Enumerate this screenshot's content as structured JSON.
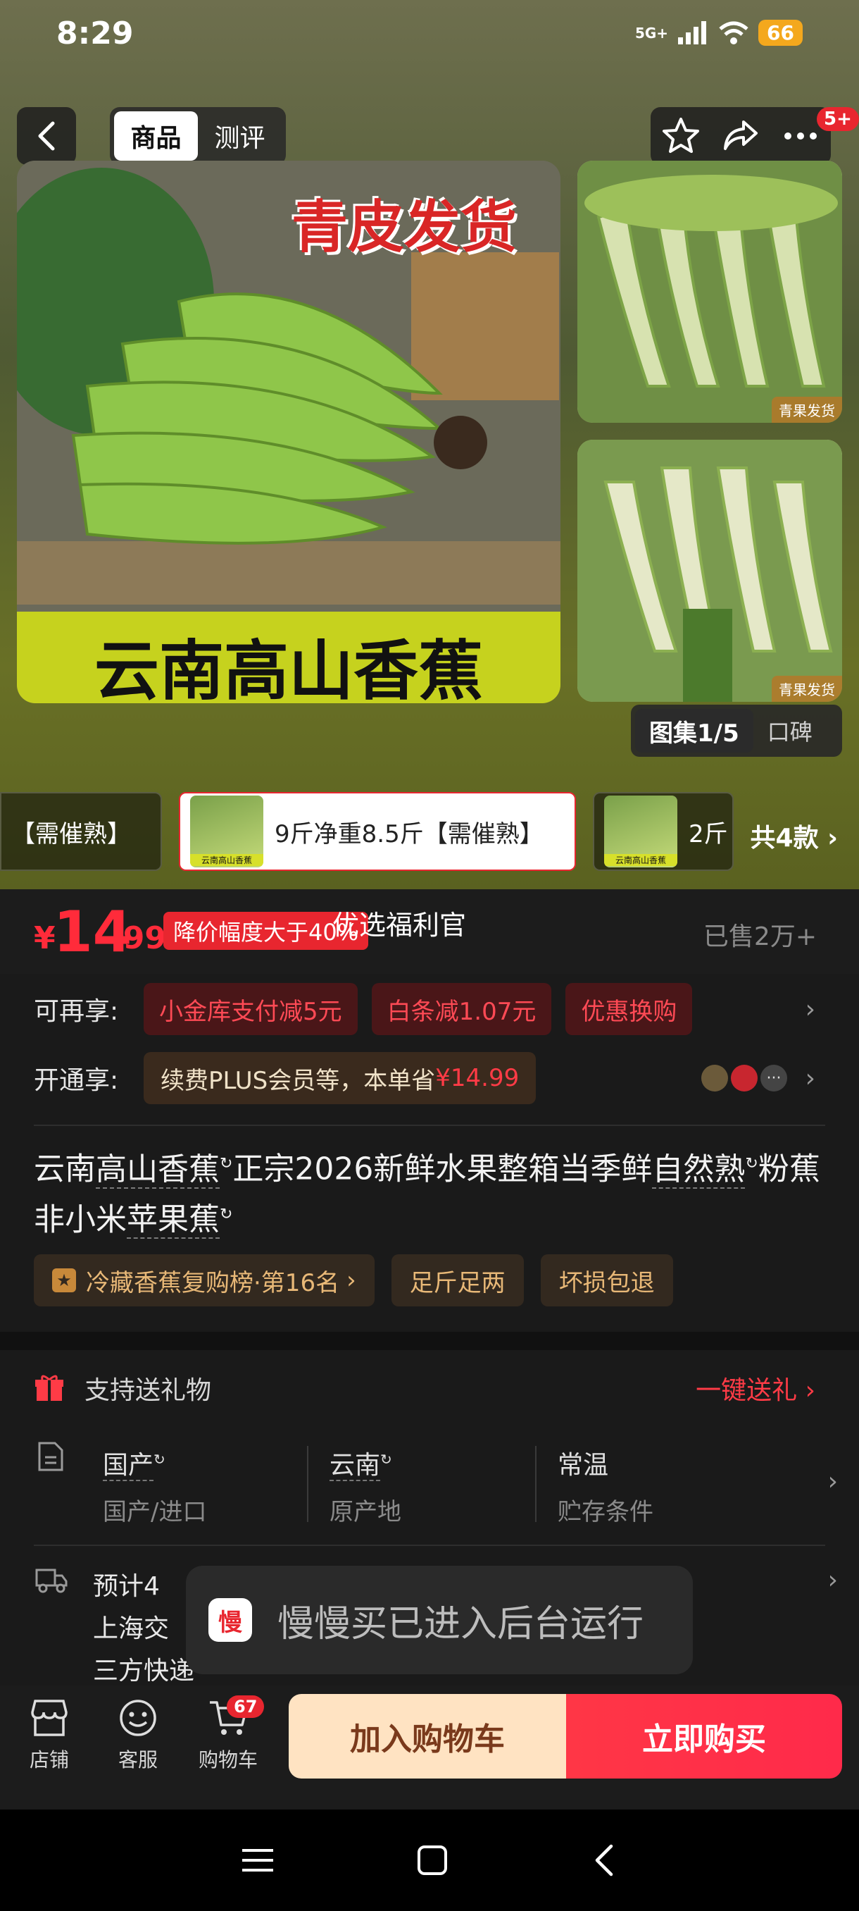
{
  "status": {
    "time": "8:29",
    "network": "5G+",
    "battery": "66"
  },
  "header": {
    "tabs": [
      {
        "label": "商品",
        "active": true
      },
      {
        "label": "测评",
        "active": false
      }
    ],
    "notification_badge": "5+"
  },
  "gallery": {
    "main_banner_top": "青皮发货",
    "main_banner_bottom": "云南高山香蕉",
    "thumb_tag": "青果发货",
    "counter": "图集1/5",
    "review_tab": "口碑"
  },
  "variants": {
    "items": [
      {
        "label": "【需催熟】",
        "selected": false
      },
      {
        "label": "9斤净重8.5斤【需催熟】",
        "selected": true
      },
      {
        "label": "2斤",
        "selected": false
      }
    ],
    "thumb_caption": "云南高山香蕉",
    "more": "共4款"
  },
  "price": {
    "currency": "¥",
    "integer": "14",
    "decimal": ".99",
    "drop_badge": "降价幅度大于40%",
    "welfare": "优选福利官",
    "sold": "已售2万+"
  },
  "benefits": {
    "label": "可再享:",
    "coupons": [
      "小金库支付减5元",
      "白条减1.07元",
      "优惠换购"
    ]
  },
  "plus": {
    "label": "开通享:",
    "text": "续费PLUS会员等，本单省",
    "amount": "¥14.99"
  },
  "product": {
    "title_parts": [
      {
        "text": "云南",
        "u": false
      },
      {
        "text": "高山香蕉",
        "u": true
      },
      {
        "text": "正宗2026新鲜水果整箱当季鲜",
        "u": false
      },
      {
        "text": "自然熟",
        "u": true
      },
      {
        "text": "粉蕉非小米",
        "u": false
      },
      {
        "text": "苹果蕉",
        "u": true
      }
    ],
    "tags": [
      "冷藏香蕉复购榜·第16名",
      "足斤足两",
      "坏损包退"
    ]
  },
  "gift": {
    "text": "支持送礼物",
    "action": "一键送礼"
  },
  "attributes": [
    {
      "value": "国产",
      "label": "国产/进口"
    },
    {
      "value": "云南",
      "label": "原产地"
    },
    {
      "value": "常温",
      "label": "贮存条件"
    }
  ],
  "shipping": {
    "line1": "预计4",
    "line2": "上海交",
    "line3": "三方快递"
  },
  "toast": {
    "icon": "慢",
    "text": "慢慢买已进入后台运行"
  },
  "bottom": {
    "store": "店铺",
    "service": "客服",
    "cart": "购物车",
    "cart_count": "67",
    "add_to_cart": "加入购物车",
    "buy_now": "立即购买"
  },
  "colors": {
    "accent": "#ff2b3a",
    "bg": "#1c1c1c",
    "gold": "#e8b877"
  }
}
